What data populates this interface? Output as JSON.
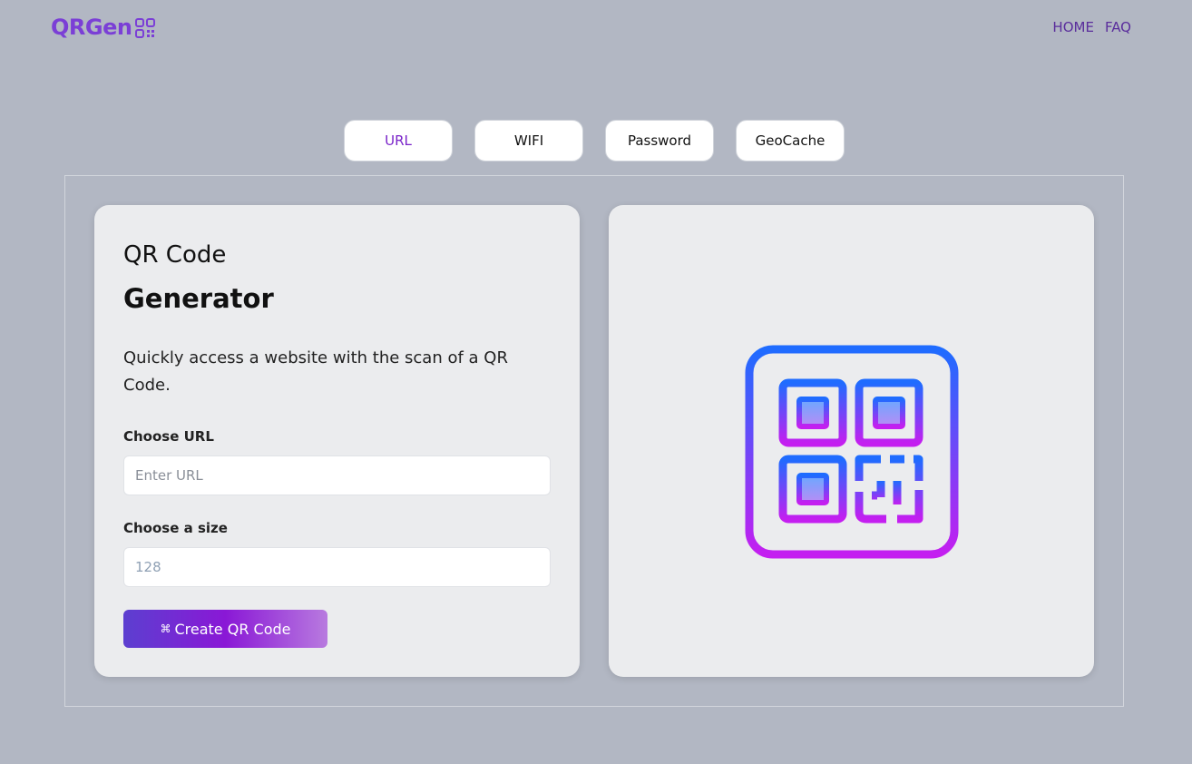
{
  "navbar": {
    "logo_text": "QRGen",
    "logo_icon": "qr-code-icon",
    "links": [
      {
        "label": "HOME"
      },
      {
        "label": "FAQ"
      }
    ]
  },
  "tabs": [
    {
      "label": "URL",
      "active": true
    },
    {
      "label": "WIFI",
      "active": false
    },
    {
      "label": "Password",
      "active": false
    },
    {
      "label": "GeoCache",
      "active": false
    }
  ],
  "form": {
    "title_line1": "QR Code",
    "title_line2": "Generator",
    "description": "Quickly access a website with the scan of a QR Code.",
    "url_label": "Choose URL",
    "url_placeholder": "Enter URL",
    "url_value": "",
    "size_label": "Choose a size",
    "size_placeholder": "128",
    "size_value": "",
    "button_icon": "⌘",
    "button_label": "Create QR Code"
  },
  "preview": {
    "icon": "qr-code-illustration-icon"
  },
  "colors": {
    "background": "#b2b7c3",
    "brand": "#7b3fd6",
    "tab_active": "#7a24c9",
    "gradient_start": "#1f6cff",
    "gradient_end": "#c41ff0"
  }
}
